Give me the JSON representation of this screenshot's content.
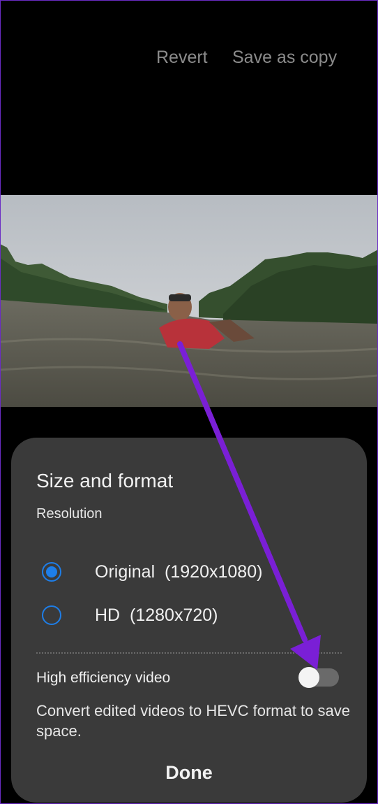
{
  "topbar": {
    "revert_label": "Revert",
    "save_copy_label": "Save as copy"
  },
  "photo": {
    "description_icon": "video-preview"
  },
  "sheet": {
    "title": "Size and format",
    "resolution_label": "Resolution",
    "options": [
      {
        "label": "Original  (1920x1080)",
        "selected": true
      },
      {
        "label": "HD  (1280x720)",
        "selected": false
      }
    ],
    "high_efficiency": {
      "label": "High efficiency video",
      "enabled": false,
      "description": "Convert edited videos to HEVC format to save space."
    },
    "done_label": "Done"
  },
  "colors": {
    "accent": "#1e7ee8",
    "sheet_bg": "#3a3a3a",
    "annotation_arrow": "#7a1fd6"
  }
}
